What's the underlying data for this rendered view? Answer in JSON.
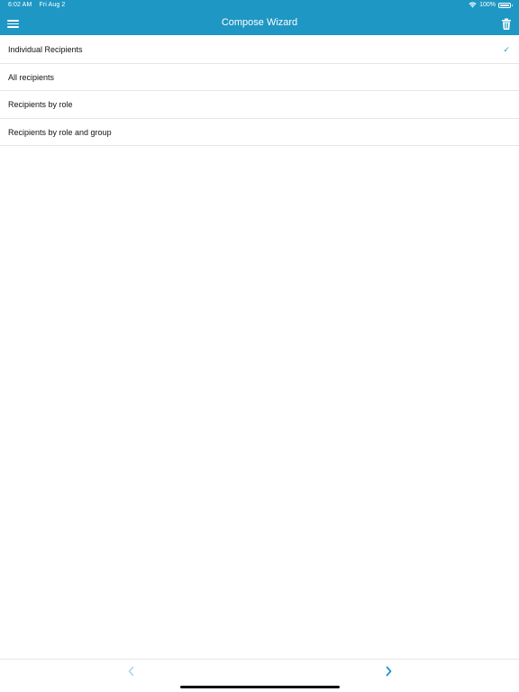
{
  "status_bar": {
    "time": "6:02 AM",
    "date": "Fri Aug 2",
    "battery": "100%",
    "battery_level": 1.0
  },
  "nav": {
    "title": "Compose Wizard",
    "menu_icon": "hamburger-menu-icon",
    "trash_icon": "trash-icon"
  },
  "options": [
    {
      "label": "Individual Recipients",
      "selected": true
    },
    {
      "label": "All recipients",
      "selected": false
    },
    {
      "label": "Recipients by role",
      "selected": false
    },
    {
      "label": "Recipients by role and group",
      "selected": false
    }
  ],
  "check_mark": "✓",
  "footer": {
    "prev_icon": "chevron-left-icon",
    "next_icon": "chevron-right-icon",
    "prev_enabled": false,
    "next_enabled": true
  },
  "colors": {
    "accent": "#1f97c4",
    "disabled": "#a9d3e6",
    "divider": "#e6e6e6"
  }
}
